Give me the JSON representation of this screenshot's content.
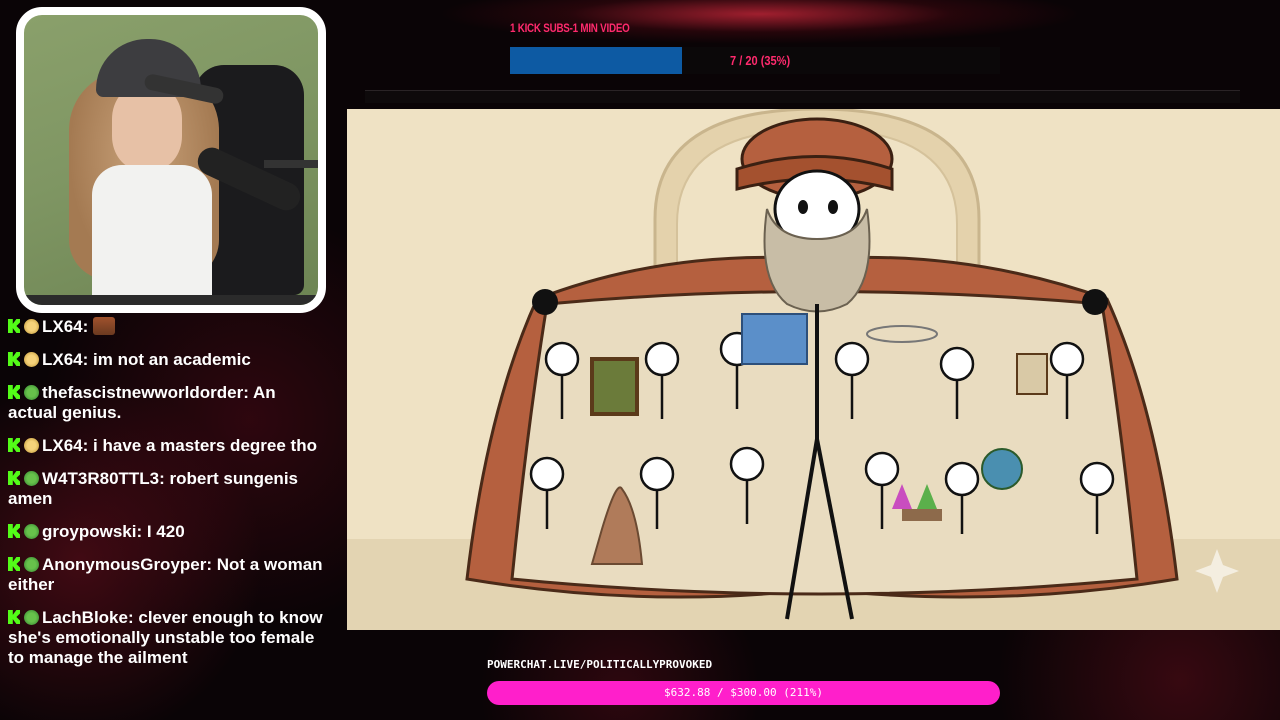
{
  "subs_goal": {
    "label": "1 KICK SUBS-1 MIN VIDEO",
    "count_text": "7 / 20 (35%)",
    "progress": 0.35,
    "fill_color": "#0d5aa3",
    "text_color": "#ff2a6d"
  },
  "chat": {
    "messages": [
      {
        "user": "LX64:",
        "text": "",
        "badge": "gold",
        "emote": true
      },
      {
        "user": "LX64:",
        "text": "im not an academic",
        "badge": "gold"
      },
      {
        "user": "thefascistnewworldorder:",
        "text": "An actual genius.",
        "badge": "green"
      },
      {
        "user": "LX64:",
        "text": "i have a masters degree tho",
        "badge": "gold"
      },
      {
        "user": "W4T3R80TTL3:",
        "text": "robert sungenis amen",
        "badge": "green"
      },
      {
        "user": "groypowski:",
        "text": "I 420",
        "badge": "green"
      },
      {
        "user": "AnonymousGroyper:",
        "text": "Not a woman either",
        "badge": "green"
      },
      {
        "user": "LachBloke:",
        "text": "clever enough to know she's emotionally unstable too female to manage the ailment",
        "badge": "green"
      }
    ]
  },
  "powerchat": {
    "url": "POWERCHAT.LIVE/POLITICALLYPROVOKED",
    "progress_text": "$632.88 / $300.00 (211%)",
    "progress": 1.0,
    "color": "#ff1fcb"
  },
  "icons": {
    "kick": "kick-logo-icon",
    "gold_badge": "subscriber-badge-icon",
    "green_badge": "verified-badge-icon"
  }
}
